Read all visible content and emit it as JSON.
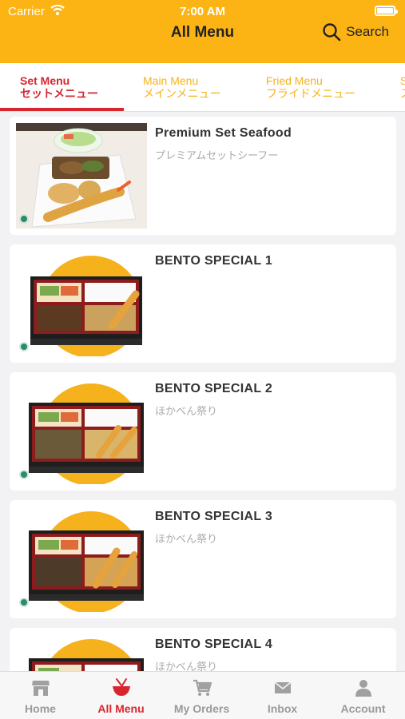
{
  "status_bar": {
    "carrier": "Carrier",
    "time": "7:00 AM",
    "battery_level": 0.9
  },
  "header": {
    "title": "All Menu",
    "search_label": "Search"
  },
  "tabs": [
    {
      "label": "Set Menu",
      "label_jp": "セットメニュー",
      "active": true
    },
    {
      "label": "Main Menu",
      "label_jp": "メインメニュー",
      "active": false
    },
    {
      "label": "Fried Menu",
      "label_jp": "フライドメニュー",
      "active": false
    },
    {
      "label": "S",
      "label_jp": "ス",
      "active": false
    }
  ],
  "menu_items": [
    {
      "name": "Premium Set Seafood",
      "subtitle": "プレミアムセットシーフー"
    },
    {
      "name": "BENTO SPECIAL 1",
      "subtitle": ""
    },
    {
      "name": "BENTO SPECIAL 2",
      "subtitle": "ほかべん祭り"
    },
    {
      "name": "BENTO SPECIAL 3",
      "subtitle": "ほかべん祭り"
    },
    {
      "name": "BENTO SPECIAL 4",
      "subtitle": "ほかべん祭り"
    }
  ],
  "bottom_nav": [
    {
      "label": "Home",
      "icon": "store-icon",
      "active": false
    },
    {
      "label": "All Menu",
      "icon": "bowl-icon",
      "active": true
    },
    {
      "label": "My Orders",
      "icon": "cart-icon",
      "active": false
    },
    {
      "label": "Inbox",
      "icon": "mail-icon",
      "active": false
    },
    {
      "label": "Account",
      "icon": "person-icon",
      "active": false
    }
  ],
  "colors": {
    "brand_yellow": "#fcb415",
    "accent_red": "#d8262f",
    "inactive_tab": "#f5b31b"
  }
}
